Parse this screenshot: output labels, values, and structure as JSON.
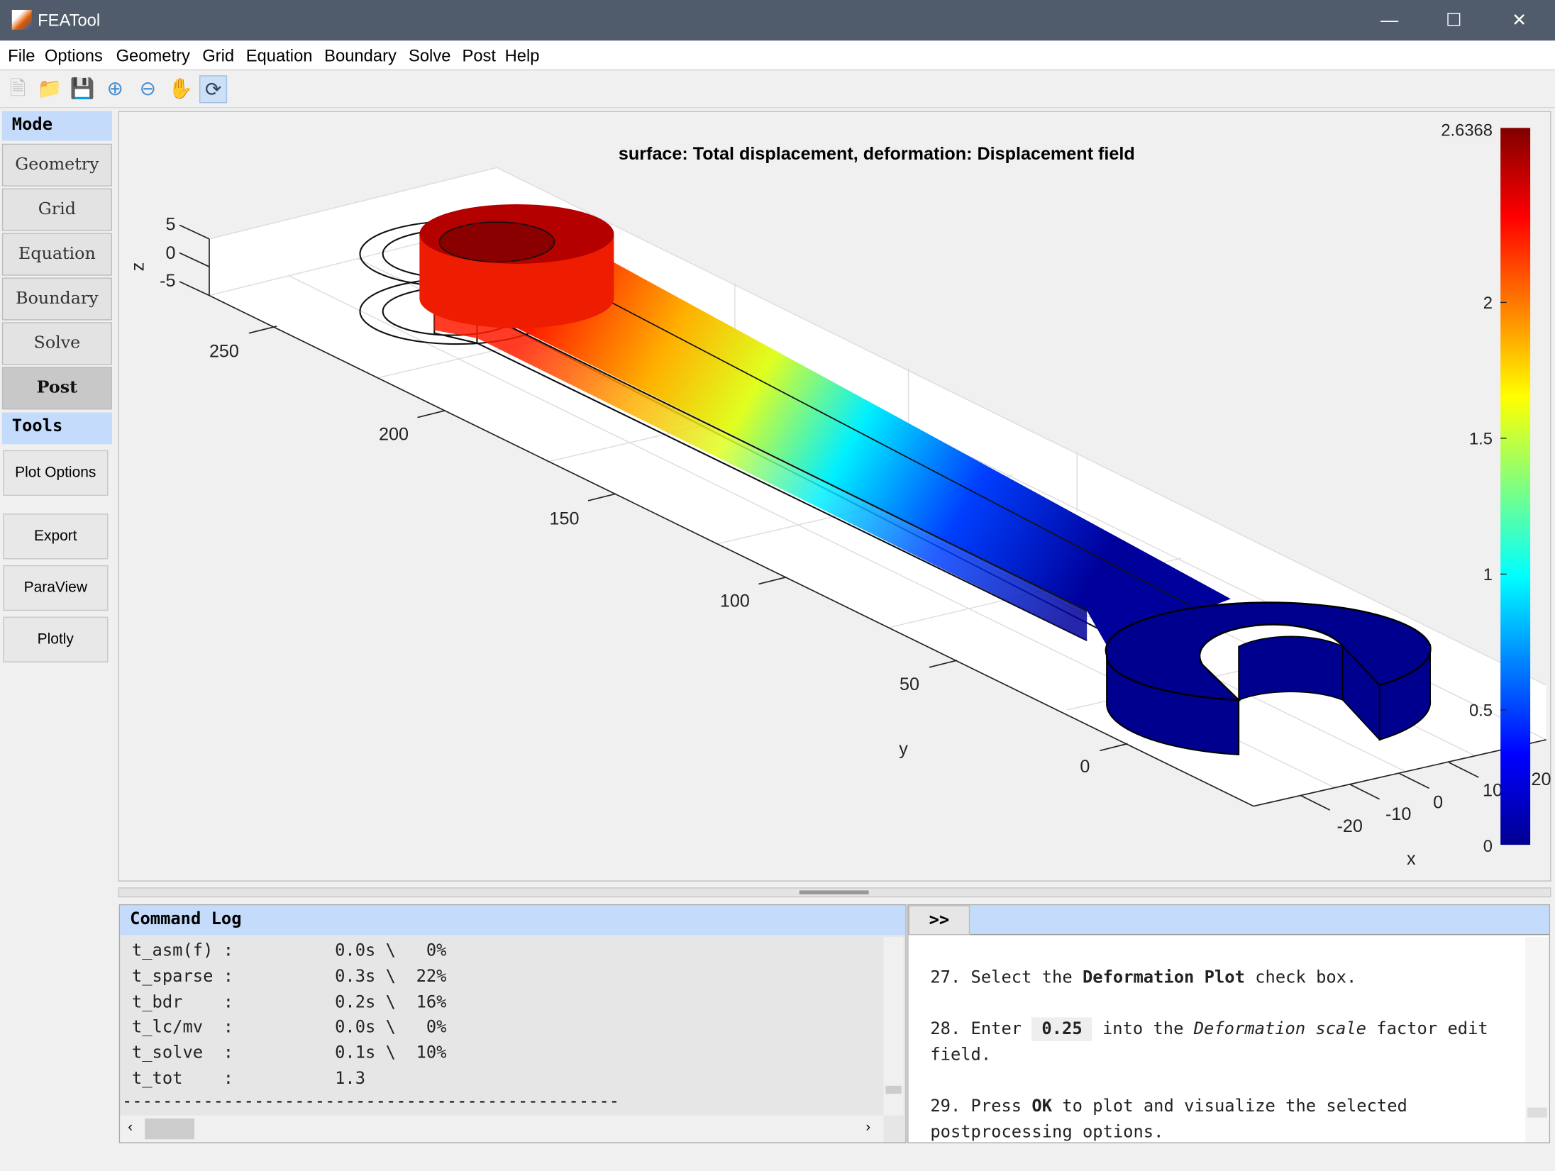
{
  "window": {
    "title": "FEATool",
    "controls": [
      "minimize",
      "maximize",
      "close"
    ]
  },
  "menu": [
    "File",
    "Options",
    "Geometry",
    "Grid",
    "Equation",
    "Boundary",
    "Solve",
    "Post",
    "Help"
  ],
  "toolbar": [
    "new-file-icon",
    "open-folder-icon",
    "save-icon",
    "zoom-in-icon",
    "zoom-out-icon",
    "pan-hand-icon",
    "rotate-icon"
  ],
  "sidebar": {
    "mode_header": "Mode",
    "modes": [
      "Geometry",
      "Grid",
      "Equation",
      "Boundary",
      "Solve",
      "Post"
    ],
    "active_mode": "Post",
    "tools_header": "Tools",
    "tools": [
      "Plot Options",
      "Export",
      "ParaView",
      "Plotly"
    ]
  },
  "plot": {
    "title": "surface: Total displacement, deformation: Displacement field",
    "z_label": "z",
    "y_label": "y",
    "x_label": "x",
    "z_ticks": [
      "5",
      "0",
      "-5"
    ],
    "y_ticks": [
      "250",
      "200",
      "150",
      "100",
      "50",
      "0"
    ],
    "x_ticks": [
      "-20",
      "-10",
      "0",
      "10",
      "20"
    ],
    "colorbar": {
      "max": "2.6368",
      "ticks": [
        "2",
        "1.5",
        "1",
        "0.5",
        "0"
      ],
      "colormap": "jet"
    },
    "colors": {
      "high": "#800000",
      "low": "#00008f"
    }
  },
  "log": {
    "title": "Command Log",
    "expand_label": ">>",
    "rows": [
      "t_asm(f) :          0.0s \\   0%",
      "t_sparse :          0.3s \\  22%",
      "t_bdr    :          0.2s \\  16%",
      "t_lc/mv  :          0.0s \\   0%",
      "t_solve  :          0.1s \\  10%",
      "t_tot    :          1.3"
    ],
    "separator": "-------------------------------------------------"
  },
  "help": {
    "s27": {
      "pre": "27. Select the ",
      "bold": "Deformation Plot",
      "post": " check box."
    },
    "s28": {
      "pre": "28. Enter ",
      "code": "0.25",
      "mid": " into the ",
      "italic": "Deformation scale",
      "post": " factor edit field."
    },
    "s29": {
      "pre": "29. Press ",
      "bold": "OK",
      "post": " to plot and visualize the selected postprocessing options."
    }
  }
}
